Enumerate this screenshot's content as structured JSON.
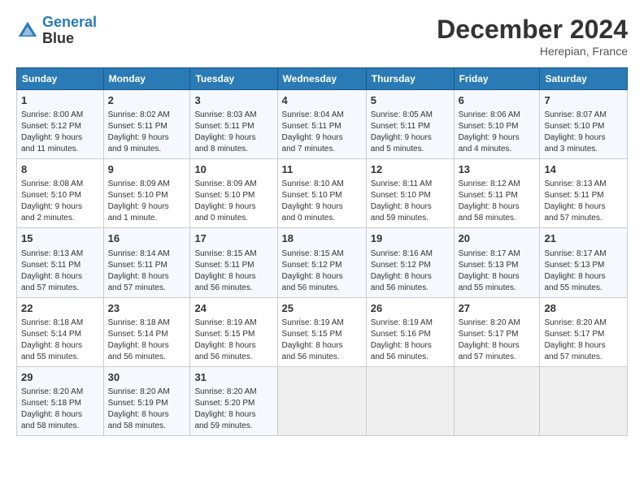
{
  "header": {
    "logo_line1": "General",
    "logo_line2": "Blue",
    "month_year": "December 2024",
    "location": "Herepian, France"
  },
  "weekdays": [
    "Sunday",
    "Monday",
    "Tuesday",
    "Wednesday",
    "Thursday",
    "Friday",
    "Saturday"
  ],
  "weeks": [
    [
      {
        "day": 1,
        "lines": [
          "Sunrise: 8:00 AM",
          "Sunset: 5:12 PM",
          "Daylight: 9 hours",
          "and 11 minutes."
        ]
      },
      {
        "day": 2,
        "lines": [
          "Sunrise: 8:02 AM",
          "Sunset: 5:11 PM",
          "Daylight: 9 hours",
          "and 9 minutes."
        ]
      },
      {
        "day": 3,
        "lines": [
          "Sunrise: 8:03 AM",
          "Sunset: 5:11 PM",
          "Daylight: 9 hours",
          "and 8 minutes."
        ]
      },
      {
        "day": 4,
        "lines": [
          "Sunrise: 8:04 AM",
          "Sunset: 5:11 PM",
          "Daylight: 9 hours",
          "and 7 minutes."
        ]
      },
      {
        "day": 5,
        "lines": [
          "Sunrise: 8:05 AM",
          "Sunset: 5:11 PM",
          "Daylight: 9 hours",
          "and 5 minutes."
        ]
      },
      {
        "day": 6,
        "lines": [
          "Sunrise: 8:06 AM",
          "Sunset: 5:10 PM",
          "Daylight: 9 hours",
          "and 4 minutes."
        ]
      },
      {
        "day": 7,
        "lines": [
          "Sunrise: 8:07 AM",
          "Sunset: 5:10 PM",
          "Daylight: 9 hours",
          "and 3 minutes."
        ]
      }
    ],
    [
      {
        "day": 8,
        "lines": [
          "Sunrise: 8:08 AM",
          "Sunset: 5:10 PM",
          "Daylight: 9 hours",
          "and 2 minutes."
        ]
      },
      {
        "day": 9,
        "lines": [
          "Sunrise: 8:09 AM",
          "Sunset: 5:10 PM",
          "Daylight: 9 hours",
          "and 1 minute."
        ]
      },
      {
        "day": 10,
        "lines": [
          "Sunrise: 8:09 AM",
          "Sunset: 5:10 PM",
          "Daylight: 9 hours",
          "and 0 minutes."
        ]
      },
      {
        "day": 11,
        "lines": [
          "Sunrise: 8:10 AM",
          "Sunset: 5:10 PM",
          "Daylight: 9 hours",
          "and 0 minutes."
        ]
      },
      {
        "day": 12,
        "lines": [
          "Sunrise: 8:11 AM",
          "Sunset: 5:10 PM",
          "Daylight: 8 hours",
          "and 59 minutes."
        ]
      },
      {
        "day": 13,
        "lines": [
          "Sunrise: 8:12 AM",
          "Sunset: 5:11 PM",
          "Daylight: 8 hours",
          "and 58 minutes."
        ]
      },
      {
        "day": 14,
        "lines": [
          "Sunrise: 8:13 AM",
          "Sunset: 5:11 PM",
          "Daylight: 8 hours",
          "and 57 minutes."
        ]
      }
    ],
    [
      {
        "day": 15,
        "lines": [
          "Sunrise: 8:13 AM",
          "Sunset: 5:11 PM",
          "Daylight: 8 hours",
          "and 57 minutes."
        ]
      },
      {
        "day": 16,
        "lines": [
          "Sunrise: 8:14 AM",
          "Sunset: 5:11 PM",
          "Daylight: 8 hours",
          "and 57 minutes."
        ]
      },
      {
        "day": 17,
        "lines": [
          "Sunrise: 8:15 AM",
          "Sunset: 5:11 PM",
          "Daylight: 8 hours",
          "and 56 minutes."
        ]
      },
      {
        "day": 18,
        "lines": [
          "Sunrise: 8:15 AM",
          "Sunset: 5:12 PM",
          "Daylight: 8 hours",
          "and 56 minutes."
        ]
      },
      {
        "day": 19,
        "lines": [
          "Sunrise: 8:16 AM",
          "Sunset: 5:12 PM",
          "Daylight: 8 hours",
          "and 56 minutes."
        ]
      },
      {
        "day": 20,
        "lines": [
          "Sunrise: 8:17 AM",
          "Sunset: 5:13 PM",
          "Daylight: 8 hours",
          "and 55 minutes."
        ]
      },
      {
        "day": 21,
        "lines": [
          "Sunrise: 8:17 AM",
          "Sunset: 5:13 PM",
          "Daylight: 8 hours",
          "and 55 minutes."
        ]
      }
    ],
    [
      {
        "day": 22,
        "lines": [
          "Sunrise: 8:18 AM",
          "Sunset: 5:14 PM",
          "Daylight: 8 hours",
          "and 55 minutes."
        ]
      },
      {
        "day": 23,
        "lines": [
          "Sunrise: 8:18 AM",
          "Sunset: 5:14 PM",
          "Daylight: 8 hours",
          "and 56 minutes."
        ]
      },
      {
        "day": 24,
        "lines": [
          "Sunrise: 8:19 AM",
          "Sunset: 5:15 PM",
          "Daylight: 8 hours",
          "and 56 minutes."
        ]
      },
      {
        "day": 25,
        "lines": [
          "Sunrise: 8:19 AM",
          "Sunset: 5:15 PM",
          "Daylight: 8 hours",
          "and 56 minutes."
        ]
      },
      {
        "day": 26,
        "lines": [
          "Sunrise: 8:19 AM",
          "Sunset: 5:16 PM",
          "Daylight: 8 hours",
          "and 56 minutes."
        ]
      },
      {
        "day": 27,
        "lines": [
          "Sunrise: 8:20 AM",
          "Sunset: 5:17 PM",
          "Daylight: 8 hours",
          "and 57 minutes."
        ]
      },
      {
        "day": 28,
        "lines": [
          "Sunrise: 8:20 AM",
          "Sunset: 5:17 PM",
          "Daylight: 8 hours",
          "and 57 minutes."
        ]
      }
    ],
    [
      {
        "day": 29,
        "lines": [
          "Sunrise: 8:20 AM",
          "Sunset: 5:18 PM",
          "Daylight: 8 hours",
          "and 58 minutes."
        ]
      },
      {
        "day": 30,
        "lines": [
          "Sunrise: 8:20 AM",
          "Sunset: 5:19 PM",
          "Daylight: 8 hours",
          "and 58 minutes."
        ]
      },
      {
        "day": 31,
        "lines": [
          "Sunrise: 8:20 AM",
          "Sunset: 5:20 PM",
          "Daylight: 8 hours",
          "and 59 minutes."
        ]
      },
      null,
      null,
      null,
      null
    ]
  ]
}
